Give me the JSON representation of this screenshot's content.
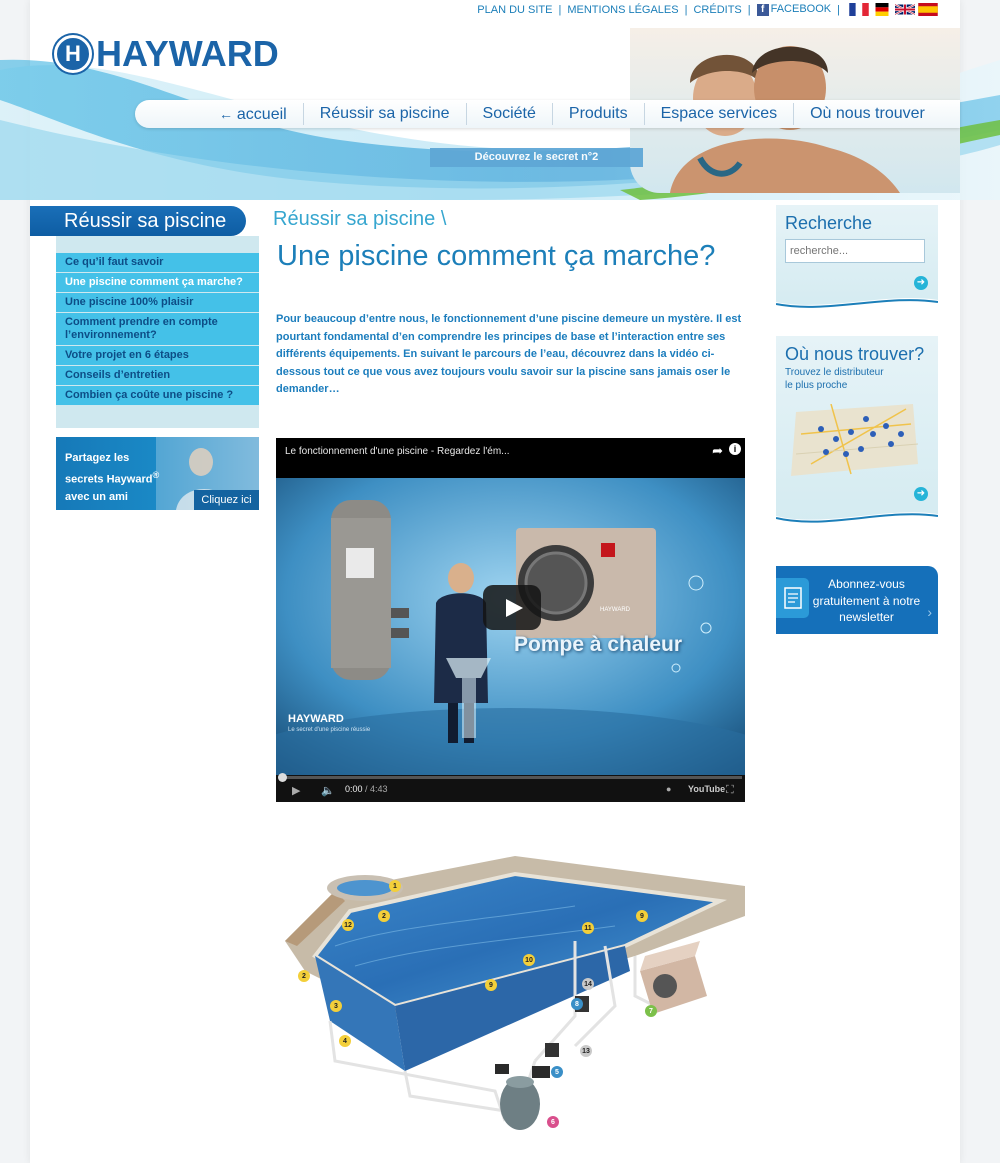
{
  "toplinks": {
    "plan": "PLAN DU SITE",
    "mentions": "MENTIONS LÉGALES",
    "credits": "CRÉDITS",
    "facebook": "FACEBOOK"
  },
  "brand": {
    "logo_text": "HAYWARD",
    "logo_mark": "H"
  },
  "nav": {
    "items": [
      "accueil",
      "Réussir sa piscine",
      "Société",
      "Produits",
      "Espace services",
      "Où nous trouver"
    ]
  },
  "promo": {
    "label": "Découvrez le secret n°2"
  },
  "sidebar": {
    "heading": "Réussir sa piscine",
    "items": [
      "Ce qu’il faut savoir",
      "Une piscine comment ça marche?",
      "Une piscine 100% plaisir",
      "Comment prendre en compte l’environnement?",
      "Votre projet en 6 étapes",
      "Conseils d’entretien",
      "Combien ça coûte une piscine ?"
    ],
    "active_index": 1,
    "share_line1": "Partagez les",
    "share_line2": "secrets Hayward",
    "share_sup": "®",
    "share_line3": "avec un ami",
    "share_button": "Cliquez ici"
  },
  "main": {
    "breadcrumb": "Réussir sa piscine \\",
    "title": "Une piscine comment ça marche?",
    "intro": "Pour beaucoup d’entre nous, le fonctionnement d’une piscine demeure un mystère. Il est pourtant fondamental d’en comprendre les principes de base et l’interaction entre ses différents équipements. En suivant le parcours de l’eau, découvrez dans la vidéo ci-dessous tout ce que vous avez toujours voulu savoir sur la piscine sans jamais oser le demander…"
  },
  "video": {
    "title": "Le fonctionnement d'une piscine - Regardez l'ém...",
    "caption": "Pompe à chaleur",
    "brand": "HAYWARD",
    "brand_sub": "Le secret d'une piscine réussie",
    "equipment_label": "HAYWARD",
    "time_current": "0:00",
    "time_total": "/ 4:43",
    "youtube": "YouTube",
    "progress": 0
  },
  "right": {
    "search_title": "Recherche",
    "search_placeholder": "recherche...",
    "locator_title": "Où nous trouver?",
    "locator_sub1": "Trouvez le distributeur",
    "locator_sub2": "le plus proche",
    "newsletter": "Abonnez-vous gratuitement à notre newsletter"
  },
  "diagram": {
    "callouts": [
      "1",
      "2",
      "12",
      "2",
      "3",
      "4",
      "11",
      "9",
      "10",
      "9",
      "14",
      "8",
      "13",
      "5",
      "6",
      "7"
    ]
  },
  "colors": {
    "brand_blue": "#1b64a8",
    "accent_cyan": "#44c1e8",
    "link_blue": "#1c7fb9"
  }
}
